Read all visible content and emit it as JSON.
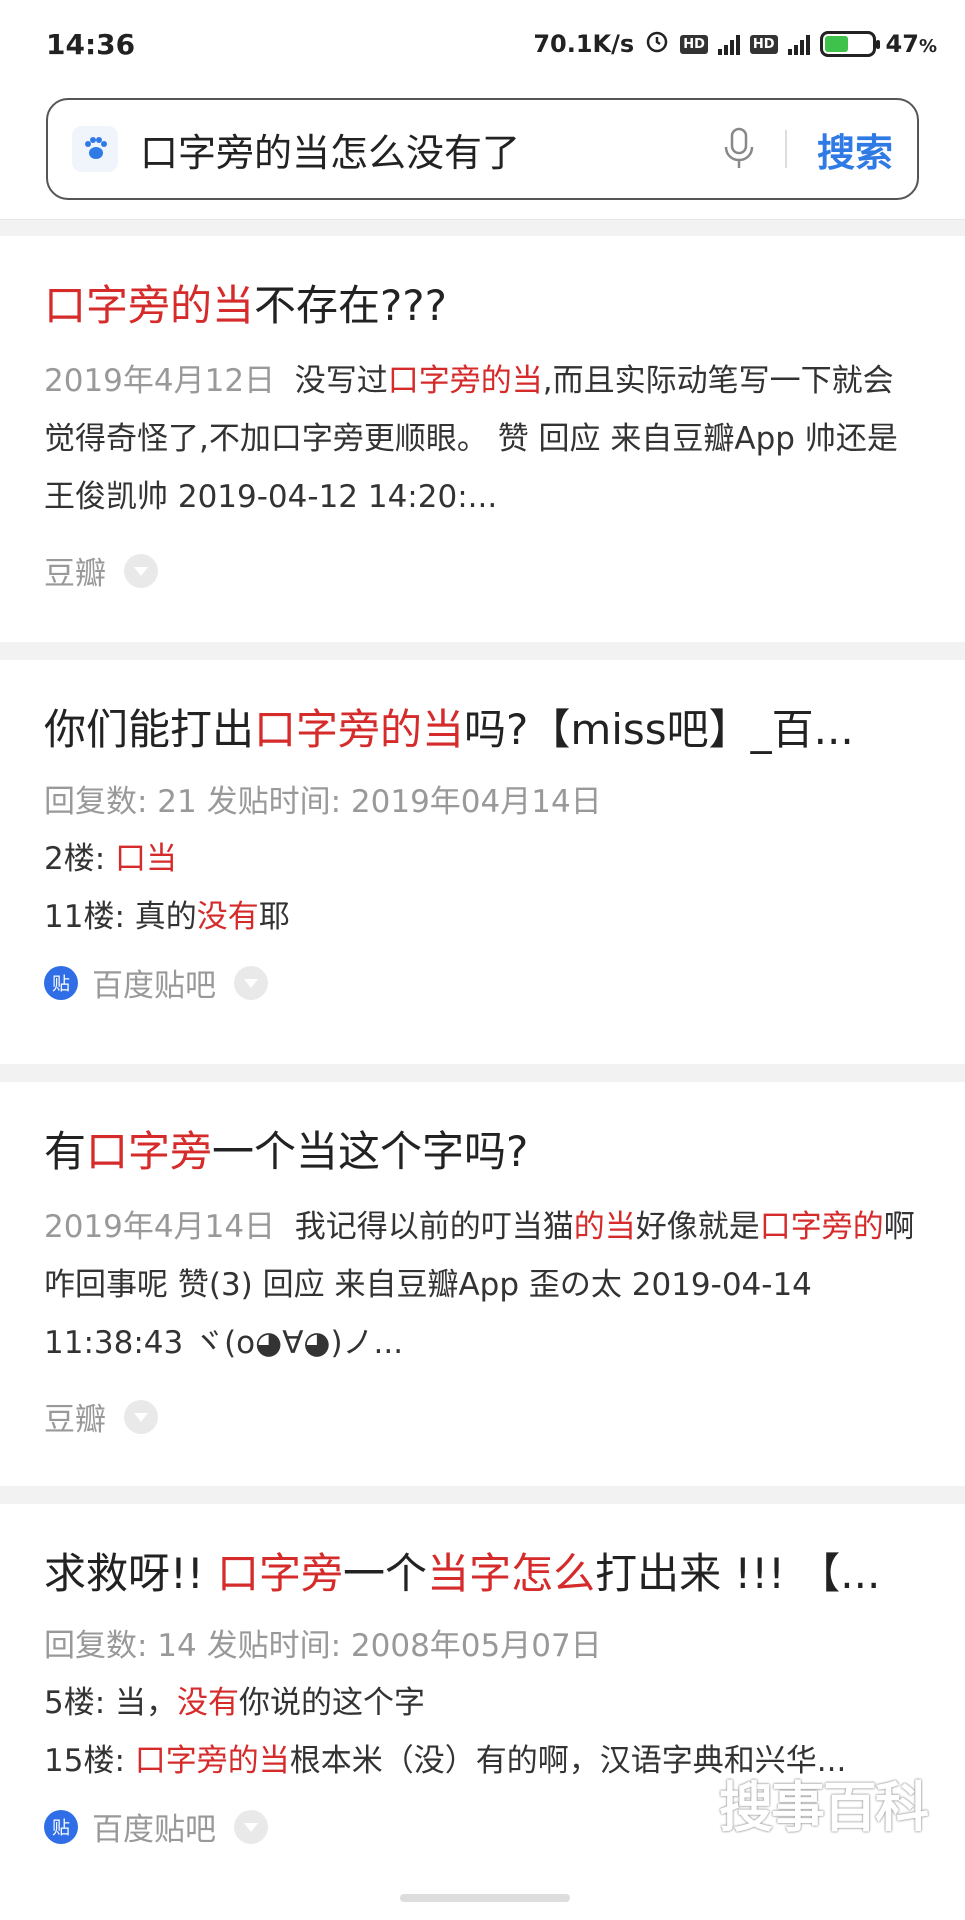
{
  "status_bar": {
    "time": "14:36",
    "net_speed": "70.1K/s",
    "hd1": "HD",
    "hd2": "HD",
    "battery": "47",
    "battery_unit": "%",
    "icons": [
      "alarm-icon",
      "signal-icon",
      "battery-icon"
    ]
  },
  "search": {
    "query": "口字旁的当怎么没有了",
    "button_label": "搜索",
    "icons": [
      "baidu-paw-icon",
      "microphone-icon"
    ]
  },
  "results": [
    {
      "title_parts": [
        {
          "text": "口字旁的当",
          "hl": true
        },
        {
          "text": "不存在???",
          "hl": false
        }
      ],
      "date": "2019年4月12日",
      "snippet_parts": [
        {
          "text": "没写过",
          "hl": false
        },
        {
          "text": "口字旁的当",
          "hl": true
        },
        {
          "text": ",而且实际动笔写一下就会觉得奇怪了,不加口字旁更顺眼。 赞 回应 来自豆瓣App 帅还是王俊凯帅 2019-04-12 14:20:...",
          "hl": false
        }
      ],
      "source": "豆瓣"
    },
    {
      "title_parts": [
        {
          "text": "你们能打出",
          "hl": false
        },
        {
          "text": "口字旁的当",
          "hl": true
        },
        {
          "text": "吗?【miss吧】_百...",
          "hl": false
        }
      ],
      "meta": "回复数: 21   发贴时间: 2019年04月14日",
      "floors": [
        {
          "label": "2楼: ",
          "parts": [
            {
              "text": "口当",
              "hl": true
            }
          ]
        },
        {
          "label": "11楼: ",
          "parts": [
            {
              "text": "真的",
              "hl": false
            },
            {
              "text": "没有",
              "hl": true
            },
            {
              "text": "耶",
              "hl": false
            }
          ]
        }
      ],
      "source": "百度贴吧",
      "source_logo": "贴"
    },
    {
      "title_parts": [
        {
          "text": "有",
          "hl": false
        },
        {
          "text": "口字旁",
          "hl": true
        },
        {
          "text": "一个当这个字吗?",
          "hl": false
        }
      ],
      "date": "2019年4月14日",
      "snippet_parts": [
        {
          "text": "我记得以前的叮当猫",
          "hl": false
        },
        {
          "text": "的当",
          "hl": true
        },
        {
          "text": "好像就是",
          "hl": false
        },
        {
          "text": "口字旁的",
          "hl": true
        },
        {
          "text": "啊 咋回事呢 赞(3) 回应 来自豆瓣App 歪の太 2019-04-14 11:38:43 ヾ(o◕∀◕)ノ...",
          "hl": false
        }
      ],
      "source": "豆瓣"
    },
    {
      "title_parts": [
        {
          "text": "求救呀!! ",
          "hl": false
        },
        {
          "text": "口字旁",
          "hl": true
        },
        {
          "text": "一个",
          "hl": false
        },
        {
          "text": "当字怎么",
          "hl": true
        },
        {
          "text": "打出来 !!! 【...",
          "hl": false
        }
      ],
      "meta": "回复数: 14   发贴时间: 2008年05月07日",
      "floors": [
        {
          "label": "5楼: ",
          "parts": [
            {
              "text": "当，",
              "hl": false
            },
            {
              "text": "没有",
              "hl": true
            },
            {
              "text": "你说的这个字",
              "hl": false
            }
          ]
        },
        {
          "label": "15楼: ",
          "parts": [
            {
              "text": "口字旁的当",
              "hl": true
            },
            {
              "text": "根本米（没）有的啊，汉语字典和兴华...",
              "hl": false
            }
          ]
        }
      ],
      "source": "百度贴吧",
      "source_logo": "贴"
    }
  ],
  "watermark": "搜事百科",
  "colors": {
    "highlight": "#d62b2b",
    "search_button": "#2f7ae5",
    "meta": "#999999"
  }
}
